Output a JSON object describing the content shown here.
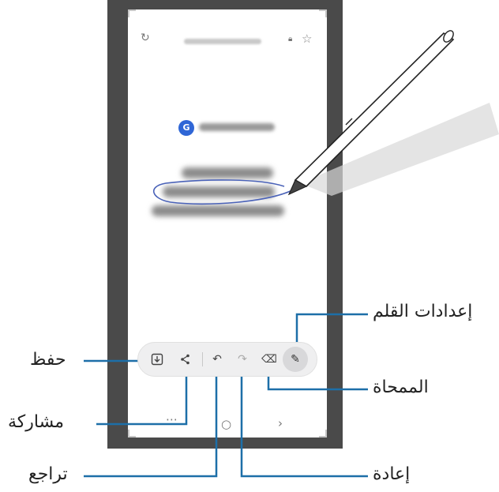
{
  "browser": {
    "reload_icon": "reload-icon",
    "lock_icon": "lock-icon",
    "favorite_icon": "star-icon"
  },
  "toolbar": {
    "save_icon": "save-icon",
    "share_icon": "share-icon",
    "undo_icon": "undo-icon",
    "redo_icon": "redo-icon",
    "eraser_icon": "eraser-icon",
    "pen_settings_icon": "pen-icon"
  },
  "callouts": {
    "pen_settings": "إعدادات القلم",
    "save": "حفظ",
    "eraser": "الممحاة",
    "share": "مشاركة",
    "undo": "تراجع",
    "redo": "إعادة"
  },
  "colors": {
    "callout_line": "#1d6fa8",
    "phone_frame": "#4a4a4a",
    "annotation_ink": "#4a62b8"
  }
}
